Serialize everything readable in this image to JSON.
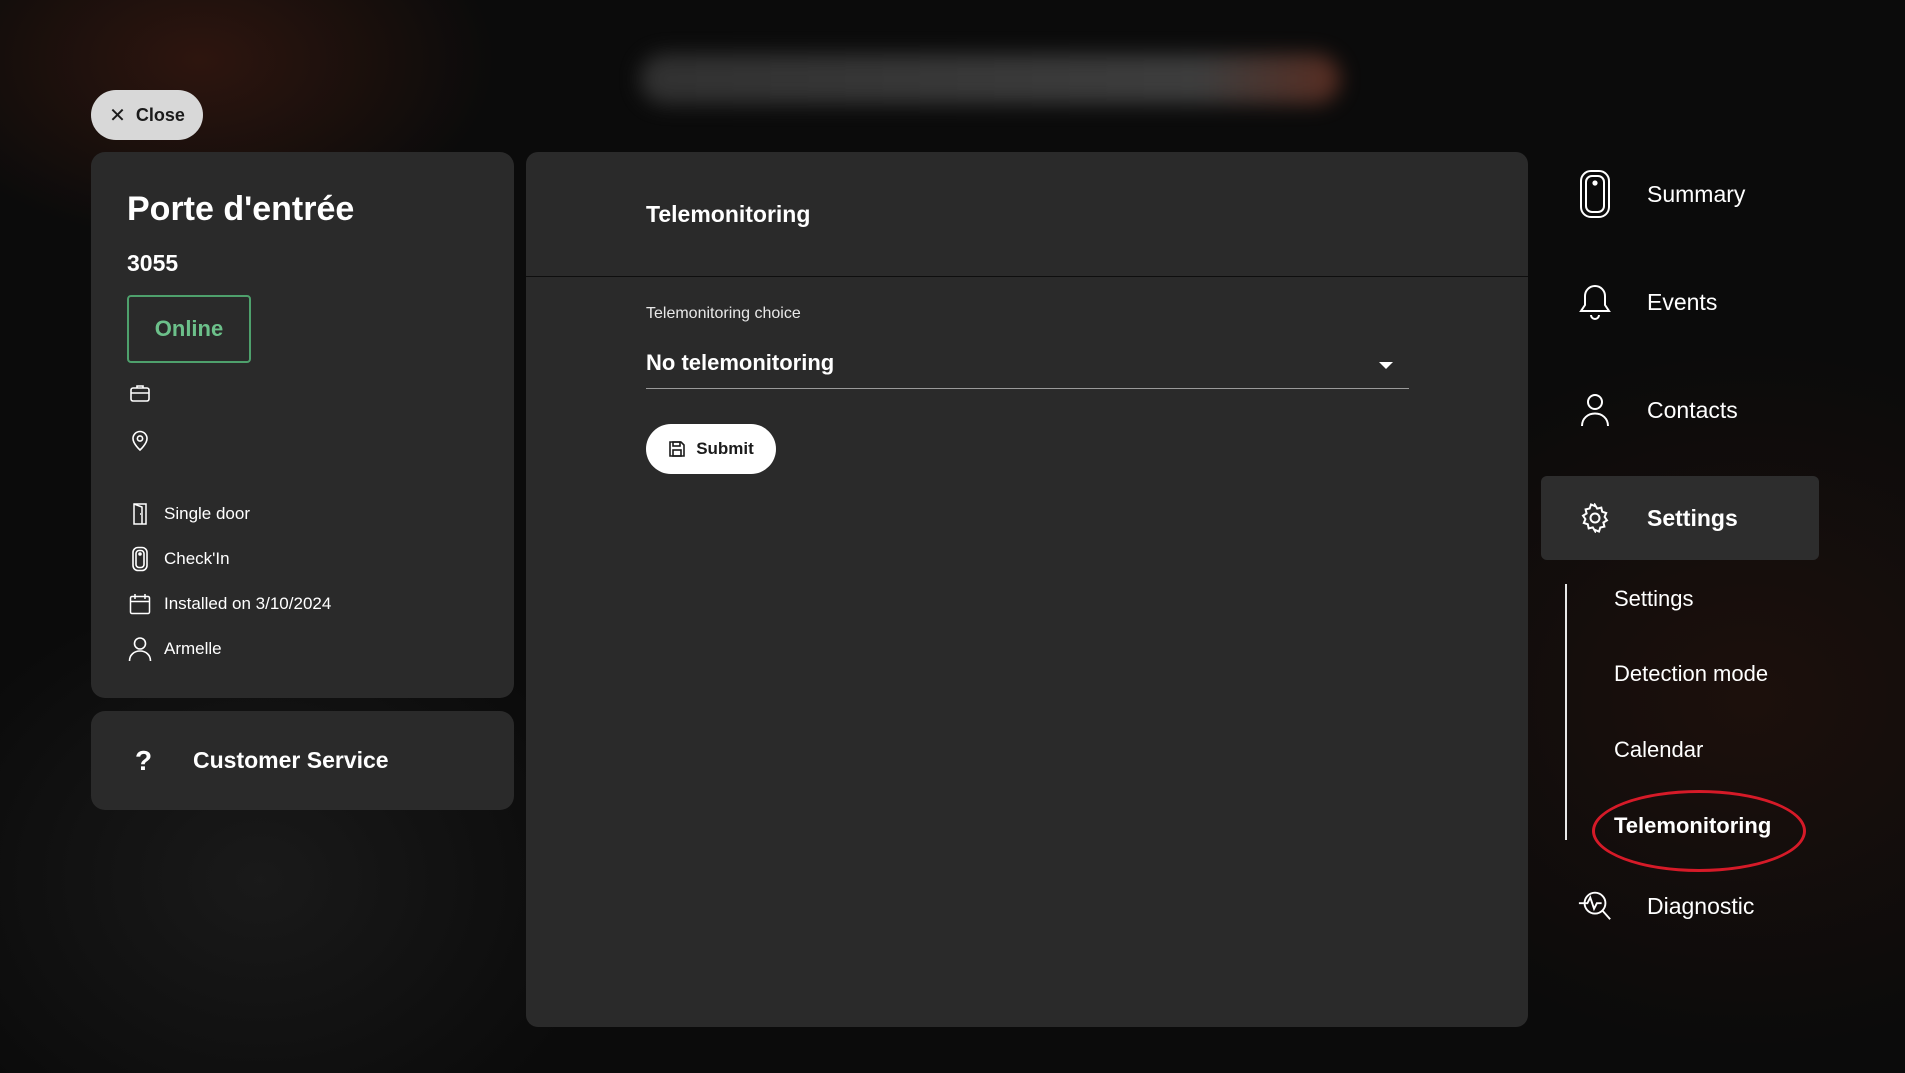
{
  "top_bar": {
    "close_label": "Close"
  },
  "device": {
    "name": "Porte d'entrée",
    "id": "3055",
    "status": "Online",
    "details": [
      {
        "icon": "door-icon",
        "text": "Single door"
      },
      {
        "icon": "sensor-icon",
        "text": "Check'In"
      },
      {
        "icon": "calendar-icon",
        "text": "Installed on 3/10/2024"
      },
      {
        "icon": "user-icon",
        "text": "Armelle"
      }
    ]
  },
  "customer_service": {
    "label": "Customer Service",
    "icon": "question-icon"
  },
  "main": {
    "title": "Telemonitoring",
    "field_label": "Telemonitoring choice",
    "field_value": "No telemonitoring",
    "submit_label": "Submit"
  },
  "nav": {
    "items": [
      {
        "label": "Summary",
        "icon": "sensor-icon"
      },
      {
        "label": "Events",
        "icon": "bell-icon"
      },
      {
        "label": "Contacts",
        "icon": "user-icon"
      },
      {
        "label": "Settings",
        "icon": "gear-icon"
      },
      {
        "label": "Diagnostic",
        "icon": "diagnostic-icon"
      }
    ],
    "sub_items": [
      {
        "label": "Settings"
      },
      {
        "label": "Detection mode"
      },
      {
        "label": "Calendar"
      },
      {
        "label": "Telemonitoring"
      }
    ]
  },
  "colors": {
    "panel": "#2a2a2a",
    "online_green": "#4ea06c",
    "highlight_red": "#d61a28"
  }
}
